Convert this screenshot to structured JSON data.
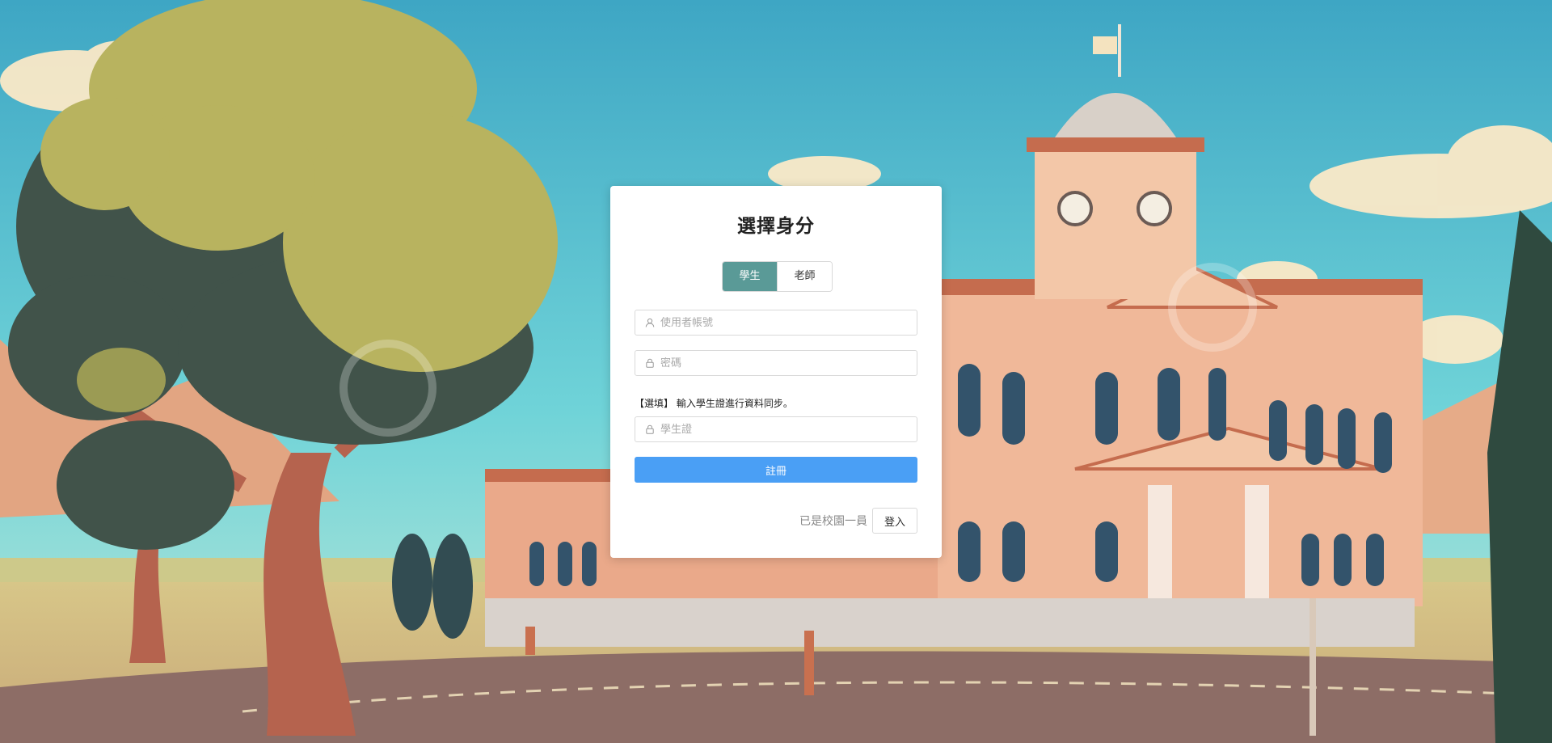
{
  "card": {
    "title": "選擇身分",
    "roles": [
      "學生",
      "老師"
    ],
    "active_role": "學生",
    "username": {
      "value": "",
      "placeholder": "使用者帳號",
      "icon": "user-icon"
    },
    "password": {
      "value": "",
      "placeholder": "密碼",
      "icon": "lock-icon"
    },
    "student_id_note": "【選填】 輸入學生證進行資料同步。",
    "student_id": {
      "value": "",
      "placeholder": "學生證",
      "icon": "lock-icon"
    },
    "submit_label": "註冊",
    "login_hint": "已是校園一員",
    "login_label": "登入"
  },
  "colors": {
    "active_role": "#5a9a97",
    "primary_button": "#4a9ff5"
  }
}
